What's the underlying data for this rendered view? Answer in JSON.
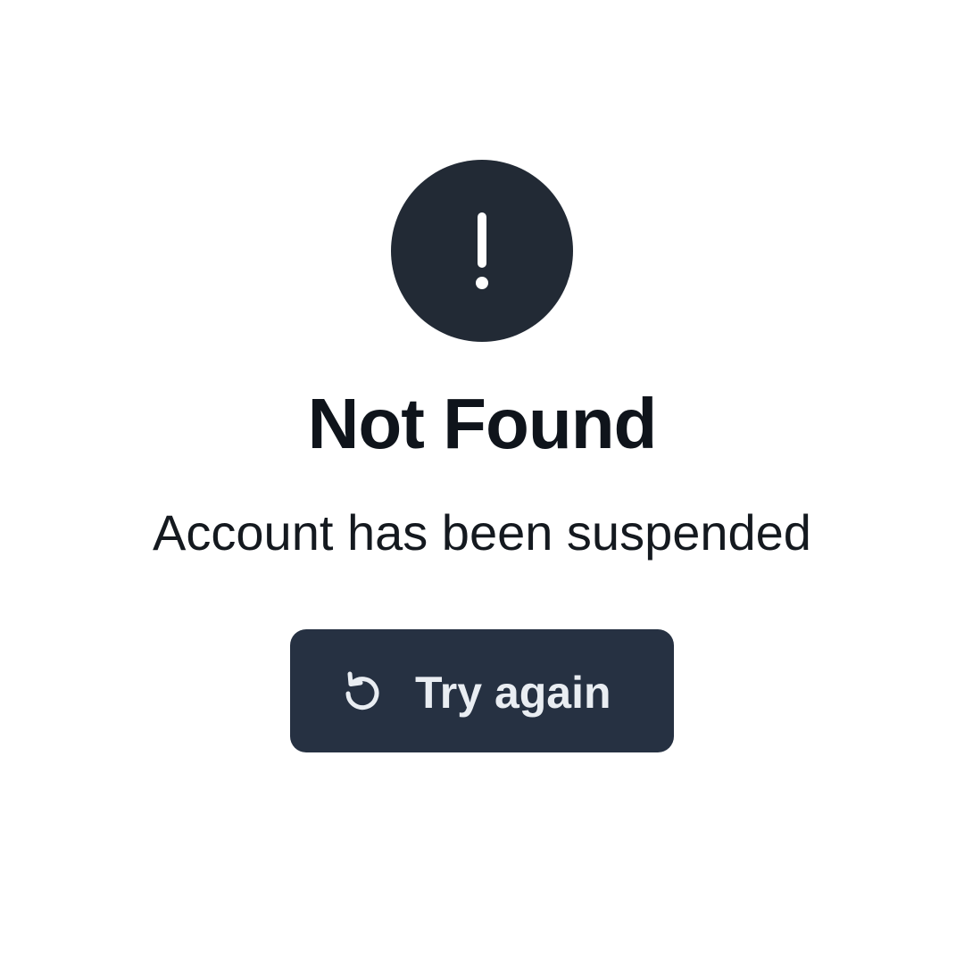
{
  "error": {
    "icon": "exclamation-icon",
    "title": "Not Found",
    "message": "Account has been suspended"
  },
  "action": {
    "icon": "refresh-icon",
    "label": "Try again"
  },
  "colors": {
    "background": "#ffffff",
    "badge": "#222a35",
    "title_text": "#0f141b",
    "message_text": "#14191f",
    "button_background": "#263142",
    "button_text": "#e9edf2"
  }
}
